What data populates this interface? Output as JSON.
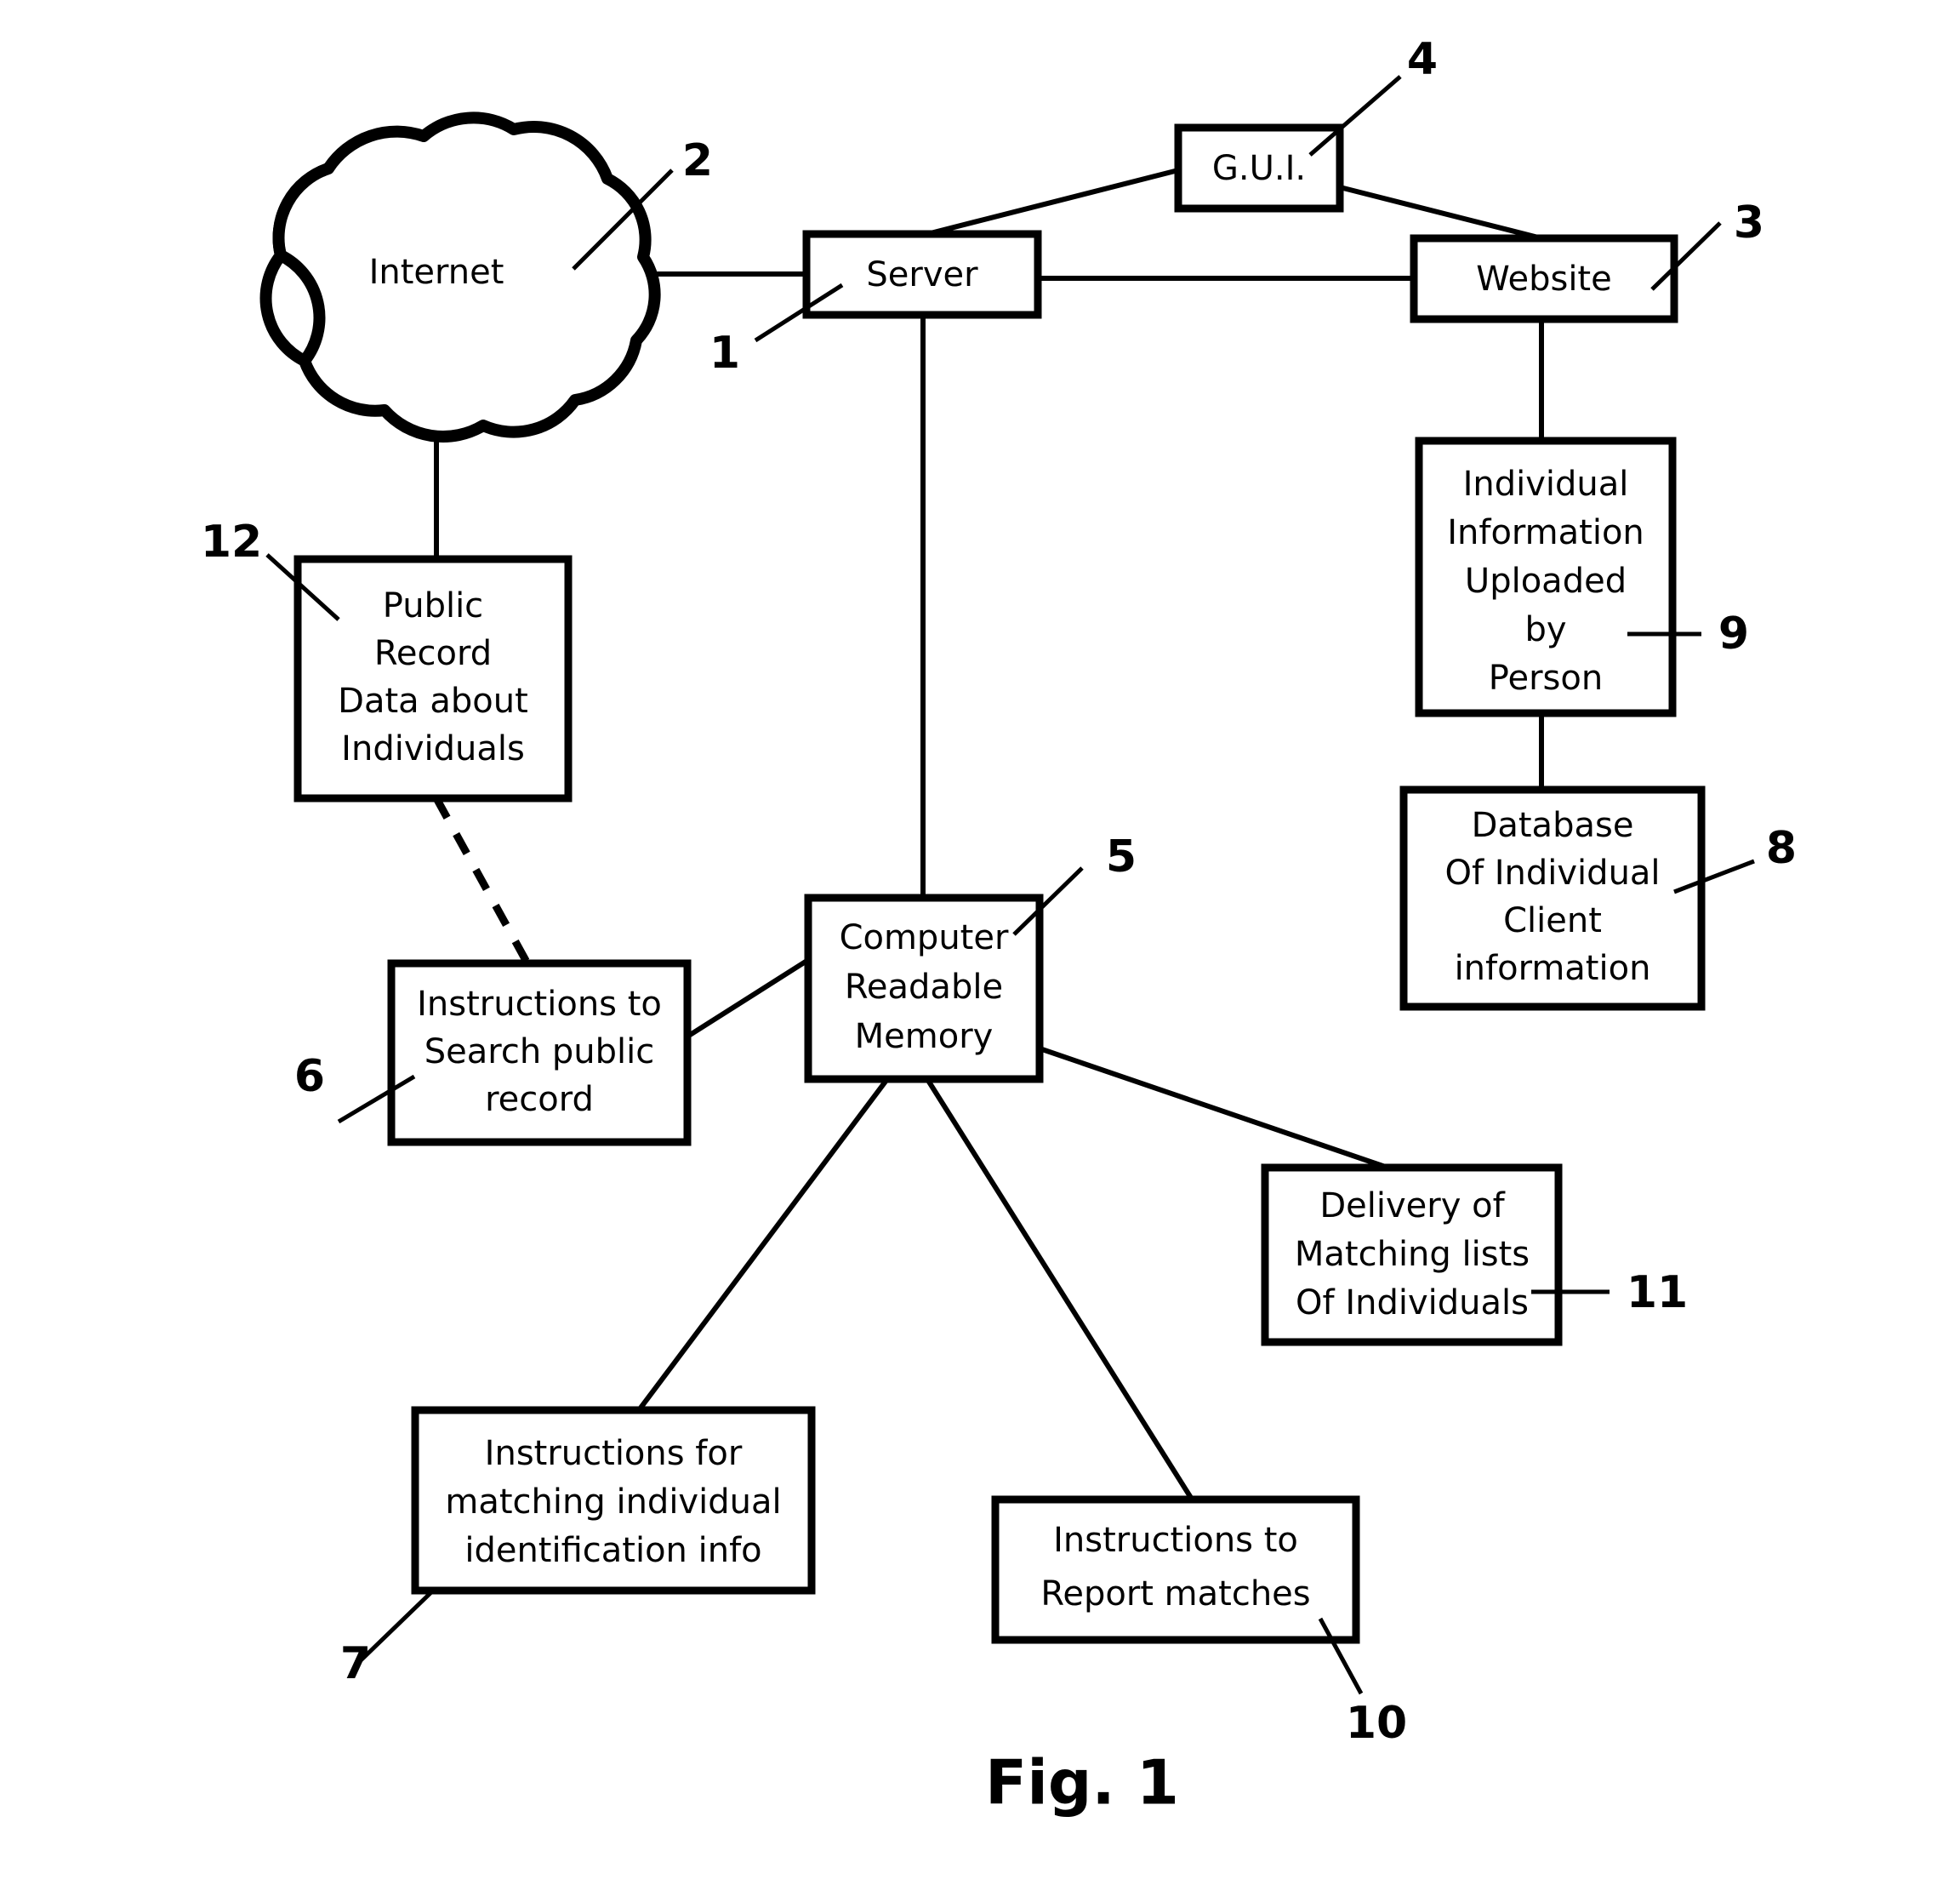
{
  "figure": {
    "caption": "Fig. 1"
  },
  "nodes": {
    "internet": {
      "label": "Internet",
      "ref": "2",
      "shape": "cloud"
    },
    "server": {
      "label": "Server",
      "ref": "1",
      "shape": "box"
    },
    "gui": {
      "label": "G.U.I.",
      "ref": "4",
      "shape": "box"
    },
    "website": {
      "label": "Website",
      "ref": "3",
      "shape": "box"
    },
    "public_record": {
      "ref": "12",
      "shape": "box",
      "lines": [
        "Public",
        "Record",
        "Data about",
        "Individuals"
      ]
    },
    "uploaded_info": {
      "ref": "9",
      "shape": "box",
      "lines": [
        "Individual",
        "Information",
        "Uploaded",
        "by",
        "Person"
      ]
    },
    "database": {
      "ref": "8",
      "shape": "box",
      "lines": [
        "Database",
        "Of Individual",
        "Client",
        "information"
      ]
    },
    "search_instructions": {
      "ref": "6",
      "shape": "box",
      "lines": [
        "Instructions to",
        "Search public",
        "record"
      ]
    },
    "memory": {
      "ref": "5",
      "shape": "box",
      "lines": [
        "Computer",
        "Readable",
        "Memory"
      ]
    },
    "delivery": {
      "ref": "11",
      "shape": "box",
      "lines": [
        "Delivery of",
        "Matching lists",
        "Of Individuals"
      ]
    },
    "matching_instructions": {
      "ref": "7",
      "shape": "box",
      "lines": [
        "Instructions for",
        "matching individual",
        "identification info"
      ]
    },
    "report_instructions": {
      "ref": "10",
      "shape": "box",
      "lines": [
        "Instructions to",
        "Report matches"
      ]
    }
  },
  "colors": {
    "stroke": "#000000",
    "fill": "#ffffff"
  }
}
